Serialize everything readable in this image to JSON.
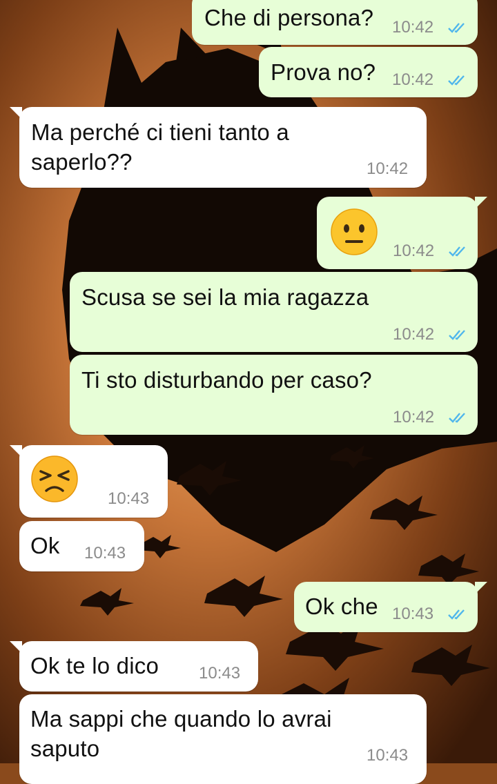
{
  "colors": {
    "outgoing_bubble": "#e7fed7",
    "incoming_bubble": "#ffffff",
    "read_ticks": "#4fb6ec",
    "timestamp": "#8b8b8b"
  },
  "wallpaper": {
    "icon": "bat-silhouette-wallpaper"
  },
  "messages": [
    {
      "dir": "out",
      "text": "Che di persona?",
      "time": "10:42",
      "status": "read-ticks-icon"
    },
    {
      "dir": "out",
      "text": "Prova no?",
      "time": "10:42",
      "status": "read-ticks-icon"
    },
    {
      "dir": "in",
      "text_lines": [
        "Ma perché ci tieni tanto a",
        "saperlo??"
      ],
      "time": "10:42"
    },
    {
      "dir": "out",
      "emoji": "neutral-face-emoji",
      "time": "10:42",
      "status": "read-ticks-icon"
    },
    {
      "dir": "out",
      "text": "Scusa se sei la mia ragazza",
      "time": "10:42",
      "status": "read-ticks-icon"
    },
    {
      "dir": "out",
      "text": "Ti sto disturbando per caso?",
      "time": "10:42",
      "status": "read-ticks-icon"
    },
    {
      "dir": "in",
      "emoji": "persevering-face-emoji",
      "time": "10:43"
    },
    {
      "dir": "in",
      "text": "Ok",
      "time": "10:43"
    },
    {
      "dir": "out",
      "text": "Ok che",
      "time": "10:43",
      "status": "read-ticks-icon"
    },
    {
      "dir": "in",
      "text": "Ok te lo dico",
      "time": "10:43"
    },
    {
      "dir": "in",
      "text_lines": [
        "Ma sappi che quando lo avrai",
        "saputo"
      ],
      "time": "10:43"
    }
  ]
}
